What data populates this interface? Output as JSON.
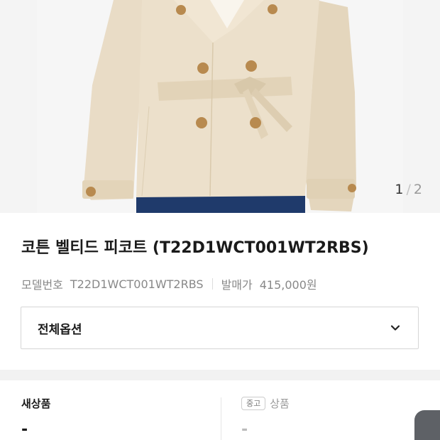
{
  "gallery": {
    "current": "1",
    "separator": "/",
    "total": "2",
    "image_icon": "trench-coat-photo"
  },
  "product": {
    "title": "코튼 벨티드 피코트 (T22D1WCT001WT2RBS)",
    "model_label": "모델번호",
    "model_value": "T22D1WCT001WT2RBS",
    "release_label": "발매가",
    "release_value": "415,000원"
  },
  "options": {
    "label": "전체옵션",
    "icon": "chevron-down-icon"
  },
  "prices": {
    "new_label": "새상품",
    "new_value": "-",
    "used_tag": "중고",
    "used_label": "상품",
    "used_value": "-"
  },
  "colors": {
    "coat": "#e9dcc6",
    "button": "#b88a4f",
    "jeans": "#1f3a6b",
    "background": "#f4f4f4"
  }
}
